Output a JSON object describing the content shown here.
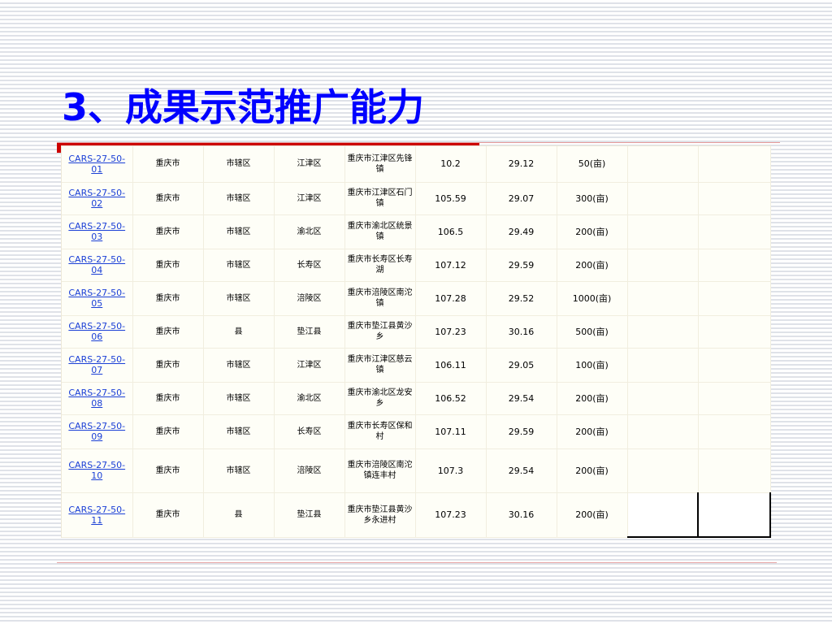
{
  "slide": {
    "title": "3、成果示范推广能力"
  },
  "table": {
    "rows": [
      {
        "id": "CARS-27-50-01",
        "city": "重庆市",
        "type": "市辖区",
        "district": "江津区",
        "location": "重庆市江津区先锋镇",
        "longitude": "10.2",
        "latitude": "29.12",
        "area": "50(亩)"
      },
      {
        "id": "CARS-27-50-02",
        "city": "重庆市",
        "type": "市辖区",
        "district": "江津区",
        "location": "重庆市江津区石门镇",
        "longitude": "105.59",
        "latitude": "29.07",
        "area": "300(亩)"
      },
      {
        "id": "CARS-27-50-03",
        "city": "重庆市",
        "type": "市辖区",
        "district": "渝北区",
        "location": "重庆市渝北区统景镇",
        "longitude": "106.5",
        "latitude": "29.49",
        "area": "200(亩)"
      },
      {
        "id": "CARS-27-50-04",
        "city": "重庆市",
        "type": "市辖区",
        "district": "长寿区",
        "location": "重庆市长寿区长寿湖",
        "longitude": "107.12",
        "latitude": "29.59",
        "area": "200(亩)"
      },
      {
        "id": "CARS-27-50-05",
        "city": "重庆市",
        "type": "市辖区",
        "district": "涪陵区",
        "location": "重庆市涪陵区南沱镇",
        "longitude": "107.28",
        "latitude": "29.52",
        "area": "1000(亩)"
      },
      {
        "id": "CARS-27-50-06",
        "city": "重庆市",
        "type": "县",
        "district": "垫江县",
        "location": "重庆市垫江县黄沙乡",
        "longitude": "107.23",
        "latitude": "30.16",
        "area": "500(亩)"
      },
      {
        "id": "CARS-27-50-07",
        "city": "重庆市",
        "type": "市辖区",
        "district": "江津区",
        "location": "重庆市江津区慈云镇",
        "longitude": "106.11",
        "latitude": "29.05",
        "area": "100(亩)"
      },
      {
        "id": "CARS-27-50-08",
        "city": "重庆市",
        "type": "市辖区",
        "district": "渝北区",
        "location": "重庆市渝北区龙安乡",
        "longitude": "106.52",
        "latitude": "29.54",
        "area": "200(亩)"
      },
      {
        "id": "CARS-27-50-09",
        "city": "重庆市",
        "type": "市辖区",
        "district": "长寿区",
        "location": "重庆市长寿区保和村",
        "longitude": "107.11",
        "latitude": "29.59",
        "area": "200(亩)"
      },
      {
        "id": "CARS-27-50-10",
        "city": "重庆市",
        "type": "市辖区",
        "district": "涪陵区",
        "location": "重庆市涪陵区南沱镇连丰村",
        "longitude": "107.3",
        "latitude": "29.54",
        "area": "200(亩)"
      },
      {
        "id": "CARS-27-50-11",
        "city": "重庆市",
        "type": "县",
        "district": "垫江县",
        "location": "重庆市垫江县黄沙乡永进村",
        "longitude": "107.23",
        "latitude": "30.16",
        "area": "200(亩)"
      }
    ]
  }
}
